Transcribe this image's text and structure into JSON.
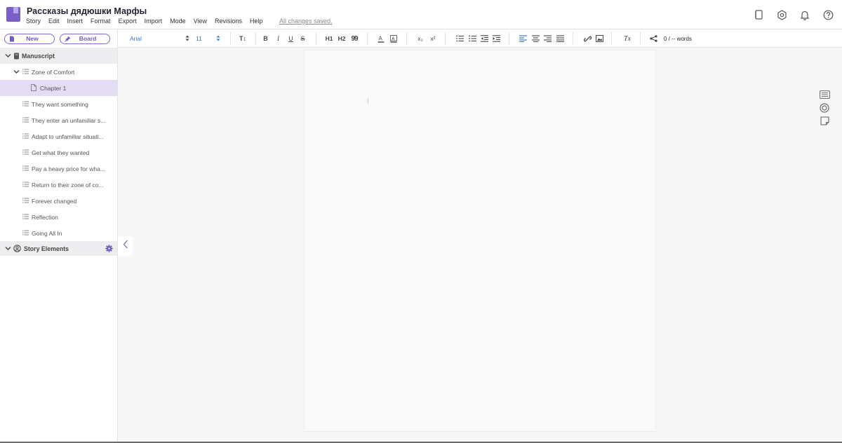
{
  "app": {
    "title": "Рассказы дядюшки Марфы",
    "menu": [
      "Story",
      "Edit",
      "Insert",
      "Format",
      "Export",
      "Import",
      "Mode",
      "View",
      "Revisions",
      "Help"
    ],
    "save_status": "All changes saved.",
    "accent_color": "#7b5fc8",
    "top_icons": [
      "notebook-icon",
      "settings-icon",
      "bell-icon",
      "help-icon"
    ]
  },
  "sidebar": {
    "new_label": "New",
    "board_label": "Board",
    "manuscript_label": "Manuscript",
    "items": [
      {
        "label": "Zone of Comfort",
        "type": "outline",
        "expanded": true
      },
      {
        "label": "Chapter 1",
        "type": "chapter",
        "selected": true
      },
      {
        "label": "They want something",
        "type": "outline"
      },
      {
        "label": "They enter an unfamiliar s...",
        "type": "outline"
      },
      {
        "label": "Adapt to unfamiliar situati...",
        "type": "outline"
      },
      {
        "label": "Get what they wanted",
        "type": "outline"
      },
      {
        "label": "Pay a heavy price for wha...",
        "type": "outline"
      },
      {
        "label": "Return to their zone of co...",
        "type": "outline"
      },
      {
        "label": "Forever changed",
        "type": "outline"
      },
      {
        "label": "Reflection",
        "type": "outline"
      },
      {
        "label": "Going All In",
        "type": "outline"
      }
    ],
    "story_elements_label": "Story Elements"
  },
  "toolbar": {
    "font_family": "Arial",
    "font_size": "11",
    "word_count": "0 / -- words",
    "b": "B",
    "i": "I",
    "u": "U",
    "s": "S",
    "h1": "H1",
    "h2": "H2",
    "quote": "99",
    "sub": "x₂",
    "sup": "x²",
    "clear": "Tx"
  }
}
